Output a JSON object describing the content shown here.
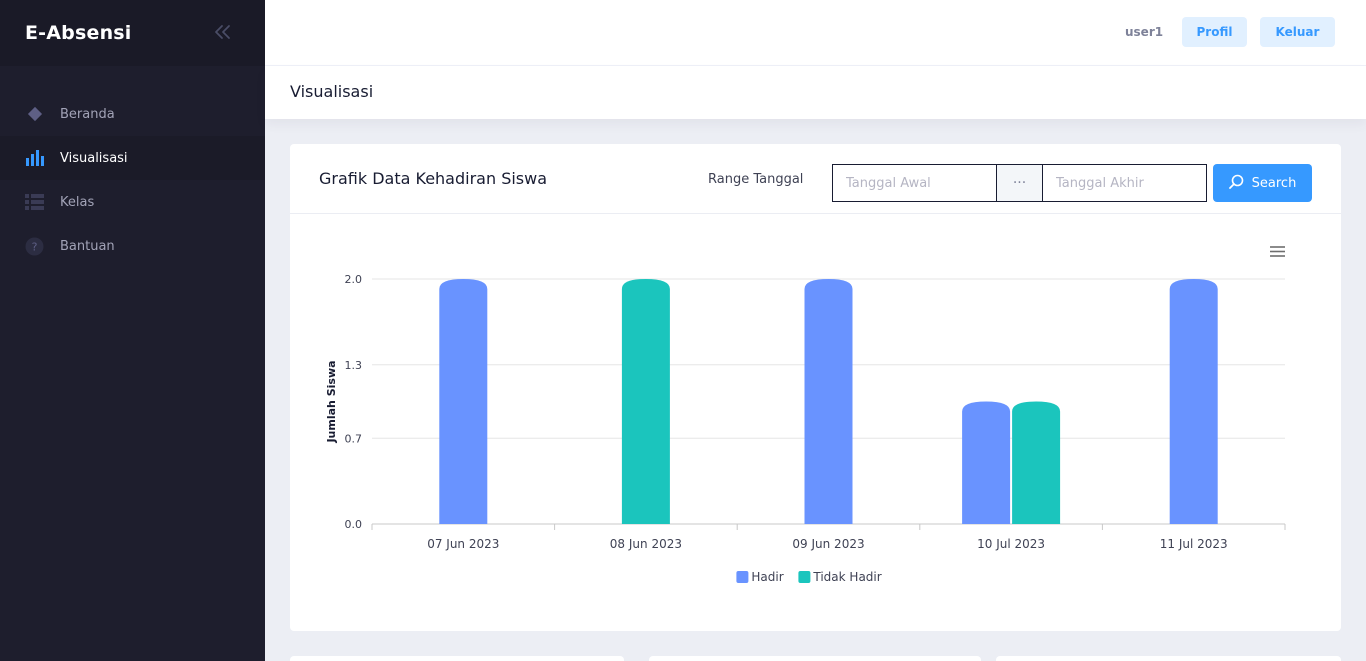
{
  "brand": {
    "title": "E-Absensi",
    "collapse_icon": "chevrons-left-icon"
  },
  "sidebar": {
    "items": [
      {
        "label": "Beranda",
        "icon": "diamond-icon",
        "active": false
      },
      {
        "label": "Visualisasi",
        "icon": "bar-chart-icon",
        "active": true
      },
      {
        "label": "Kelas",
        "icon": "list-icon",
        "active": false
      },
      {
        "label": "Bantuan",
        "icon": "question-icon",
        "active": false
      }
    ]
  },
  "header": {
    "user": "user1",
    "profil_label": "Profil",
    "keluar_label": "Keluar"
  },
  "subheader": {
    "title": "Visualisasi"
  },
  "card": {
    "title": "Grafik Data Kehadiran Siswa",
    "range_label": "Range Tanggal",
    "start_placeholder": "Tanggal Awal",
    "separator": "···",
    "end_placeholder": "Tanggal Akhir",
    "search_label": "Search"
  },
  "colors": {
    "primary": "#3699ff",
    "hadir": "#6993ff",
    "tidak_hadir": "#1bc5bd",
    "sidebar": "#1e1e2d"
  },
  "chart_data": {
    "type": "bar",
    "categories": [
      "07 Jun 2023",
      "08 Jun 2023",
      "09 Jun 2023",
      "10 Jul 2023",
      "11 Jul 2023"
    ],
    "series": [
      {
        "name": "Hadir",
        "values": [
          2,
          0,
          2,
          1,
          2
        ]
      },
      {
        "name": "Tidak Hadir",
        "values": [
          0,
          2,
          0,
          1,
          0
        ]
      }
    ],
    "ylabel": "Jumlah Siswa",
    "xlabel": "",
    "yticks": [
      "0.0",
      "0.7",
      "1.3",
      "2.0"
    ],
    "ylim": [
      0,
      2
    ],
    "legend": "bottom-center",
    "grid": true
  }
}
